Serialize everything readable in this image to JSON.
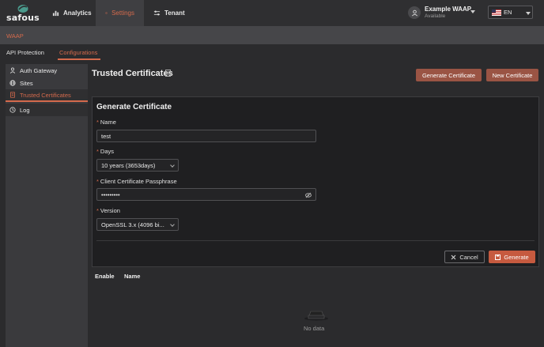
{
  "app": {
    "brand": "safous"
  },
  "nav": {
    "items": [
      {
        "label": "Analytics",
        "icon": "bar-chart-icon",
        "active": false
      },
      {
        "label": "Settings",
        "icon": "gear-icon",
        "active": true
      },
      {
        "label": "Tenant",
        "icon": "sliders-icon",
        "active": false
      }
    ]
  },
  "user": {
    "name": "Example WAAP",
    "status": "Available"
  },
  "language": {
    "code": "EN",
    "flag": "us-flag-icon"
  },
  "section": {
    "label": "WAAP"
  },
  "tabs": [
    {
      "label": "API Protection",
      "active": false
    },
    {
      "label": "Configurations",
      "active": true
    }
  ],
  "sidebar": {
    "items": [
      {
        "label": "Auth Gateway",
        "icon": "user-icon"
      },
      {
        "label": "Sites",
        "icon": "globe-icon"
      },
      {
        "label": "Trusted Certificates",
        "icon": "certificate-icon",
        "active": true
      },
      {
        "label": "Log",
        "icon": "history-icon"
      }
    ]
  },
  "page": {
    "title": "Trusted Certificates"
  },
  "actions": {
    "generate_certificate": "Generate Certificate",
    "new_certificate": "New Certificate"
  },
  "form": {
    "title": "Generate Certificate",
    "name": {
      "label": "Name",
      "value": "test"
    },
    "days": {
      "label": "Days",
      "value": "10 years (3653days)"
    },
    "passphrase": {
      "label": "Client Certificate Passphrase",
      "value": "•••••••••"
    },
    "version": {
      "label": "Version",
      "value": "OpenSSL 3.x (4096 bi..."
    },
    "cancel": "Cancel",
    "generate": "Generate"
  },
  "table": {
    "columns": [
      "Enable",
      "Name"
    ],
    "empty_text": "No data"
  },
  "colors": {
    "accent": "#d46a4c",
    "button": "#c65a3f",
    "background": "#2b2b2d"
  }
}
